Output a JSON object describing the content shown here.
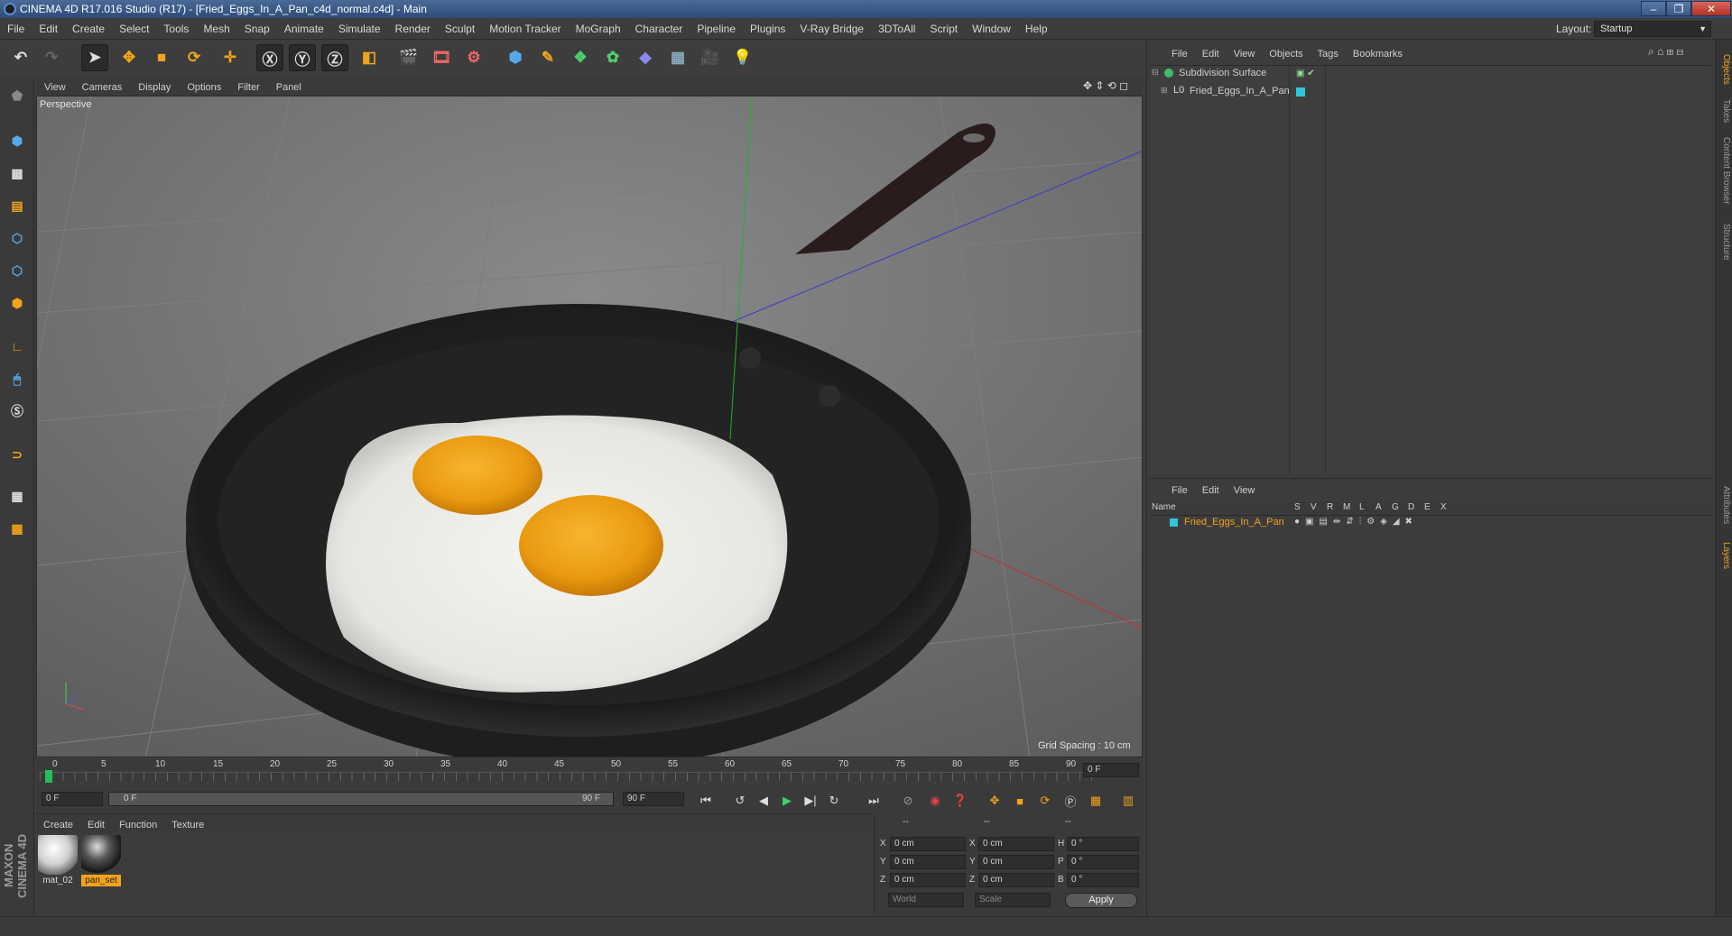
{
  "window": {
    "title": "CINEMA 4D R17.016 Studio (R17) - [Fried_Eggs_In_A_Pan_c4d_normal.c4d] - Main",
    "buttons": [
      "–",
      "❐",
      "✕"
    ]
  },
  "menu": [
    "File",
    "Edit",
    "Create",
    "Select",
    "Tools",
    "Mesh",
    "Snap",
    "Animate",
    "Simulate",
    "Render",
    "Sculpt",
    "Motion Tracker",
    "MoGraph",
    "Character",
    "Pipeline",
    "Plugins",
    "V-Ray Bridge",
    "3DToAll",
    "Script",
    "Window",
    "Help"
  ],
  "layout": {
    "label": "Layout:",
    "value": "Startup"
  },
  "viewport": {
    "menu": [
      "View",
      "Cameras",
      "Display",
      "Options",
      "Filter",
      "Panel"
    ],
    "camera_label": "Perspective",
    "grid_spacing": "Grid Spacing : 10 cm"
  },
  "timeline": {
    "ticks": [
      "0",
      "5",
      "10",
      "15",
      "20",
      "25",
      "30",
      "35",
      "40",
      "45",
      "50",
      "55",
      "60",
      "65",
      "70",
      "75",
      "80",
      "85",
      "90"
    ],
    "current_frame": "0 F",
    "start_field": "0 F",
    "range_start": "0 F",
    "range_end": "90 F",
    "end_field": "90 F"
  },
  "material_manager": {
    "menu": [
      "Create",
      "Edit",
      "Function",
      "Texture"
    ],
    "materials": [
      {
        "name": "mat_02",
        "selected": false
      },
      {
        "name": "pan_set",
        "selected": true
      }
    ]
  },
  "coordinates": {
    "headers": [
      "--",
      "--",
      "--"
    ],
    "rows": [
      {
        "a": "X",
        "a_val": "0 cm",
        "b": "X",
        "b_val": "0 cm",
        "c": "H",
        "c_val": "0 °"
      },
      {
        "a": "Y",
        "a_val": "0 cm",
        "b": "Y",
        "b_val": "0 cm",
        "c": "P",
        "c_val": "0 °"
      },
      {
        "a": "Z",
        "a_val": "0 cm",
        "b": "Z",
        "b_val": "0 cm",
        "c": "B",
        "c_val": "0 °"
      }
    ],
    "world": "World",
    "scale": "Scale",
    "apply": "Apply"
  },
  "object_manager": {
    "menu": [
      "File",
      "Edit",
      "View",
      "Objects",
      "Tags",
      "Bookmarks"
    ],
    "objects": [
      {
        "name": "Subdivision Surface",
        "color": "#c8c8c8"
      },
      {
        "name": "Fried_Eggs_In_A_Pan",
        "color": "#c8c8c8"
      }
    ]
  },
  "layer_manager": {
    "menu": [
      "File",
      "Edit",
      "View"
    ],
    "columns": [
      "Name",
      "S",
      "V",
      "R",
      "M",
      "L",
      "A",
      "G",
      "D",
      "E",
      "X"
    ],
    "layers": [
      {
        "name": "Fried_Eggs_In_A_Pan",
        "color": "#f2a31b",
        "swatch": "#2ec8d8"
      }
    ]
  },
  "side_tabs": [
    "Objects",
    "Takes",
    "Content Browser",
    "Structure",
    "Attributes",
    "Layers"
  ],
  "brand": "MAXON CINEMA 4D",
  "colors": {
    "accent": "#f2a31b",
    "title_bg": "#3a5a88",
    "close": "#c0392b"
  }
}
